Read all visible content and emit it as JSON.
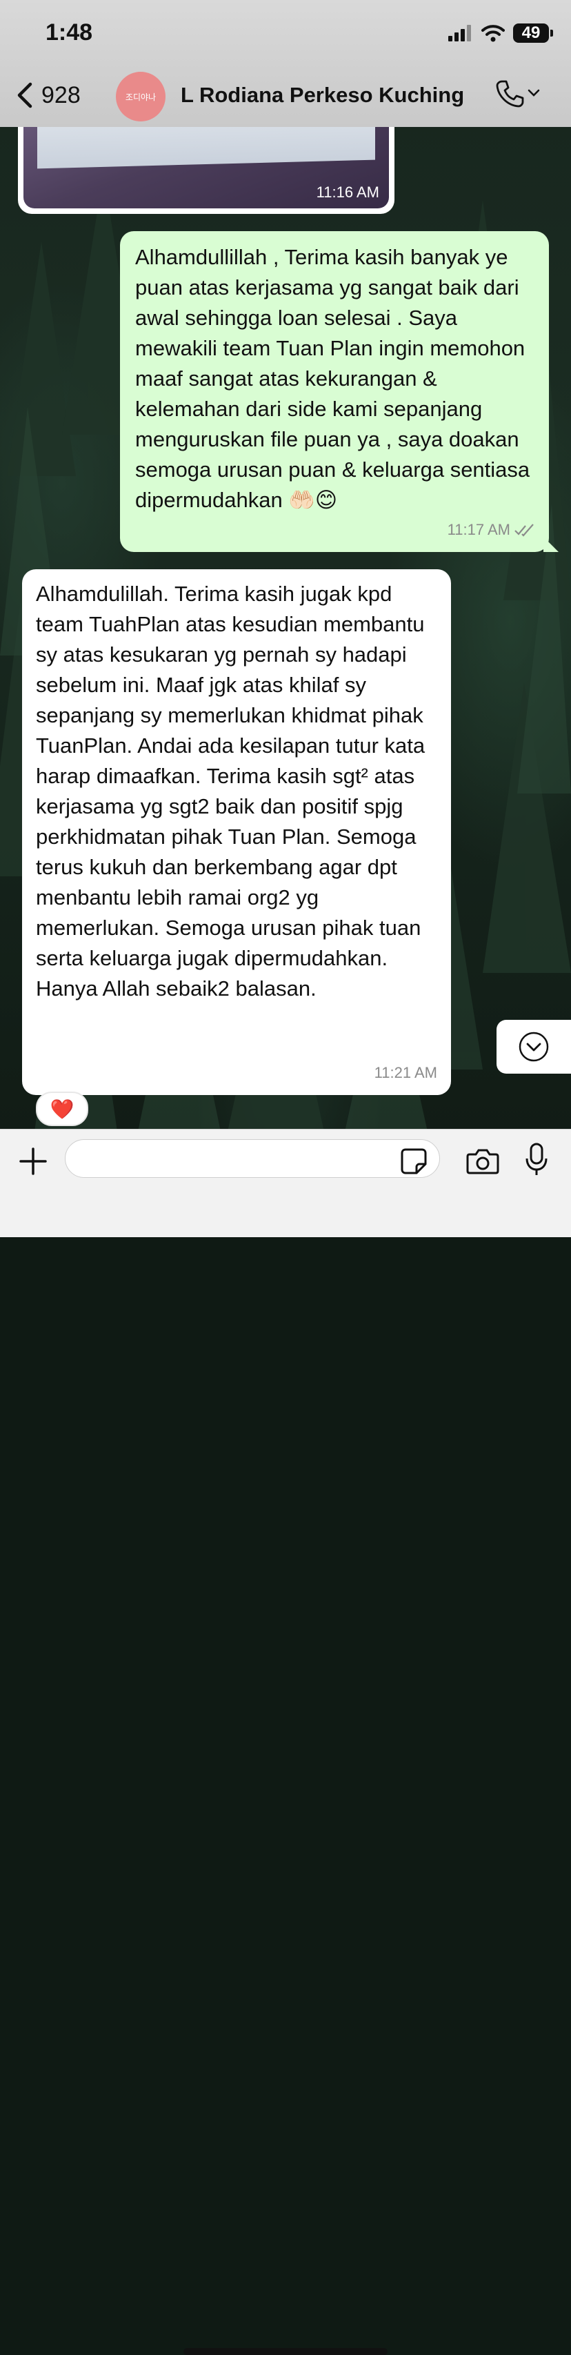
{
  "status_bar": {
    "time": "1:48",
    "battery": "49"
  },
  "header": {
    "back_count": "928",
    "avatar_text": "조디야나",
    "contact_name": "L Rodiana Perkeso Kuching"
  },
  "messages": [
    {
      "type": "image",
      "direction": "incoming",
      "time": "11:16 AM"
    },
    {
      "type": "text",
      "direction": "outgoing",
      "text": "Alhamdullillah , Terima kasih banyak ye puan atas kerjasama yg sangat baik dari awal sehingga loan selesai . Saya mewakili team Tuan Plan ingin memohon maaf sangat atas kekurangan & kelemahan dari side kami sepanjang menguruskan file puan ya , saya doakan semoga urusan puan & keluarga sentiasa dipermudahkan 🤲🏻😊",
      "time": "11:17 AM",
      "status": "read"
    },
    {
      "type": "text",
      "direction": "incoming",
      "text": "Alhamdulillah. Terima kasih jugak kpd team TuahPlan atas kesudian membantu sy atas kesukaran yg pernah sy hadapi sebelum ini. Maaf jgk atas khilaf sy sepanjang sy memerlukan khidmat pihak TuanPlan. Andai ada kesilapan tutur kata harap dimaafkan. Terima kasih sgt² atas kerjasama yg sgt2 baik dan positif spjg perkhidmatan pihak Tuan Plan. Semoga terus kukuh dan berkembang agar dpt menbantu lebih ramai org2 yg memerlukan. Semoga urusan pihak tuan serta keluarga jugak dipermudahkan. Hanya Allah sebaik2 balasan.",
      "time": "11:21 AM",
      "reaction": "❤️"
    }
  ],
  "composer": {
    "placeholder": ""
  },
  "icons": [
    "chevron-left-icon",
    "phone-icon",
    "chevron-down-icon",
    "plus-icon",
    "sticker-icon",
    "camera-icon",
    "mic-icon",
    "signal-icon",
    "wifi-icon",
    "double-check-icon"
  ]
}
